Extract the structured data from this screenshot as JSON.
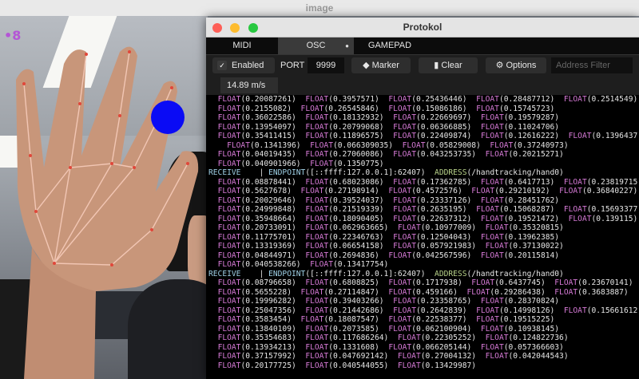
{
  "image_window": {
    "title": "image"
  },
  "protokol": {
    "title": "Protokol",
    "tabs": [
      {
        "label": "MIDI",
        "active": false
      },
      {
        "label": "OSC",
        "active": true
      },
      {
        "label": "GAMEPAD",
        "active": false
      }
    ],
    "toolbar": {
      "enabled_label": "Enabled",
      "enabled_checked": true,
      "port_label": "PORT",
      "port_value": "9999",
      "marker_label": "Marker",
      "clear_label": "Clear",
      "options_label": "Options",
      "filter_placeholder": "Address Filter",
      "speed": "14.89 m/s"
    },
    "log_lines": [
      "  FLOAT(0.20087261)  FLOAT(0.3957571)  FLOAT(0.25436446)  FLOAT(0.28487712)  FLOAT(0.2514549)",
      "  FLOAT(0.2155082)  FLOAT(0.26545846)  FLOAT(0.15086186)  FLOAT(0.15745723)",
      "  FLOAT(0.36022586)  FLOAT(0.18132932)  FLOAT(0.22669697)  FLOAT(0.19579287)",
      "  FLOAT(0.13954097)  FLOAT(0.20799068)  FLOAT(0.06366885)  FLOAT(0.11024706)",
      "  FLOAT(0.35411415)  FLOAT(0.11896575)  FLOAT(0.22409874)  FLOAT(0.12616222)  FLOAT(0.1396437)",
      "    FLOAT(0.1341396)  FLOAT(0.066309035)  FLOAT(0.05829008)  FLOAT(0.37240973)",
      "  FLOAT(0.04019435)  FLOAT(0.27060086)  FLOAT(0.043253735)  FLOAT(0.20215271)",
      "  FLOAT(0.040901966)  FLOAT(0.1350775)",
      "RECEIVE    | ENDPOINT([::ffff:127.0.0.1]:62407)  ADDRESS(/handtracking/hand0)",
      "  FLOAT(0.08878441)  FLOAT(0.68023086)  FLOAT(0.17362785)  FLOAT(0.6417713)  FLOAT(0.23819715)",
      "  FLOAT(0.5627678)  FLOAT(0.27198914)  FLOAT(0.4572576)  FLOAT(0.29210192)  FLOAT(0.36840227)",
      "  FLOAT(0.20029646)  FLOAT(0.39524037)  FLOAT(0.23337126)  FLOAT(0.28451762)",
      "  FLOAT(0.24999848)  FLOAT(0.21519339)  FLOAT(0.2635195)  FLOAT(0.15068287)  FLOAT(0.15693377)",
      "  FLOAT(0.35948664)  FLOAT(0.18090405)  FLOAT(0.22637312)  FLOAT(0.19521472)  FLOAT(0.139115)",
      "  FLOAT(0.20733091)  FLOAT(0.062963665)  FLOAT(0.10977009)  FLOAT(0.35320815)",
      "  FLOAT(0.11775701)  FLOAT(0.22346763)  FLOAT(0.12504043)  FLOAT(0.13962385)",
      "  FLOAT(0.13319369)  FLOAT(0.06654158)  FLOAT(0.057921983)  FLOAT(0.37130022)",
      "  FLOAT(0.04844971)  FLOAT(0.2694836)  FLOAT(0.042567596)  FLOAT(0.20115814)",
      "  FLOAT(0.040538266)  FLOAT(0.13417754)",
      "RECEIVE    | ENDPOINT([::ffff:127.0.0.1]:62407)  ADDRESS(/handtracking/hand0)",
      "  FLOAT(0.08796658)  FLOAT(0.6808825)  FLOAT(0.1717938)  FLOAT(0.6437745)  FLOAT(0.23670141)",
      "  FLOAT(0.5655228)  FLOAT(0.27114847)  FLOAT(0.459166)  FLOAT(0.29286438)  FLOAT(0.3683887)",
      "  FLOAT(0.19996282)  FLOAT(0.39403266)  FLOAT(0.23358765)  FLOAT(0.28370824)",
      "  FLOAT(0.25047356)  FLOAT(0.21442686)  FLOAT(0.2642839)  FLOAT(0.14998126)  FLOAT(0.15661612)",
      "  FLOAT(0.3583454)  FLOAT(0.18087547)  FLOAT(0.22538377)  FLOAT(0.19515225)",
      "  FLOAT(0.13840109)  FLOAT(0.2073585)  FLOAT(0.062100904)  FLOAT(0.10938145)",
      "  FLOAT(0.35354683)  FLOAT(0.117686264)  FLOAT(0.22305252)  FLOAT(0.124822736)",
      "  FLOAT(0.13934213)  FLOAT(0.1331608)  FLOAT(0.066205144)  FLOAT(0.057366603)",
      "  FLOAT(0.37157992)  FLOAT(0.047692142)  FLOAT(0.27004132)  FLOAT(0.042044543)",
      "  FLOAT(0.20177725)  FLOAT(0.040544055)  FLOAT(0.13429987)"
    ]
  },
  "colors": {
    "accent_pink": "#d67ad6",
    "circle_blue": "#0a0bf5",
    "close": "#fe5f57",
    "minimize": "#febc2e",
    "maximize": "#28c840"
  }
}
